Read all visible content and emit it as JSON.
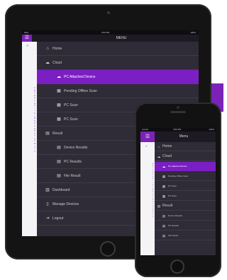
{
  "colors": {
    "accent": "#7b1fc4",
    "drawer_bg": "#2f2b37",
    "text": "#c9c9c9"
  },
  "tablet": {
    "status": {
      "carrier": "iPad",
      "time": "3:53 PM",
      "battery": "100%"
    },
    "title": "MENU",
    "hamburger_icon": "hamburger-icon",
    "alphabet": [
      "A",
      "B",
      "C",
      "D",
      "E",
      "F",
      "G",
      "H",
      "I",
      "J",
      "K",
      "L",
      "M",
      "N",
      "O",
      "P",
      "Q",
      "R",
      "S",
      "T",
      "U",
      "V",
      "W",
      "X",
      "Y",
      "Z"
    ],
    "menu": [
      {
        "label": "Home",
        "icon": "home-icon",
        "glyph": "⌂"
      },
      {
        "label": "Cloud",
        "icon": "cloud-icon",
        "glyph": "☁"
      },
      {
        "label": "PC Attached Device",
        "icon": "cloud-icon",
        "glyph": "☁"
      },
      {
        "label": "Pending Offline Scan",
        "icon": "scan-icon",
        "glyph": "▦"
      },
      {
        "label": "PC Scan",
        "icon": "scan-icon",
        "glyph": "▦"
      },
      {
        "label": "PC Scan",
        "icon": "scan-icon",
        "glyph": "▦"
      },
      {
        "label": "Result",
        "icon": "result-icon",
        "glyph": "▤"
      },
      {
        "label": "Device Results",
        "icon": "result-icon",
        "glyph": "▤"
      },
      {
        "label": "PC Results",
        "icon": "result-icon",
        "glyph": "▤"
      },
      {
        "label": "File Result",
        "icon": "result-icon",
        "glyph": "▤"
      },
      {
        "label": "Dashboard",
        "icon": "dashboard-icon",
        "glyph": "▥"
      },
      {
        "label": "Manage Devices",
        "icon": "devices-icon",
        "glyph": "▯"
      },
      {
        "label": "Logout",
        "icon": "logout-icon",
        "glyph": "⇥"
      }
    ]
  },
  "phone": {
    "status": {
      "carrier": "Carrier",
      "time": "3:56 PM",
      "battery": "100%"
    },
    "title": "Menu",
    "hamburger_icon": "hamburger-icon",
    "alphabet": [
      "A",
      "B",
      "C",
      "D",
      "E",
      "F",
      "G",
      "H",
      "I",
      "J",
      "K",
      "L",
      "M",
      "N",
      "O",
      "P",
      "Q",
      "R",
      "S",
      "T",
      "U",
      "V",
      "W",
      "X",
      "Y",
      "Z"
    ],
    "menu": [
      {
        "label": "Home",
        "icon": "home-icon",
        "glyph": "⌂"
      },
      {
        "label": "Cloud",
        "icon": "cloud-icon",
        "glyph": "☁"
      },
      {
        "label": "PC Attached Device",
        "icon": "cloud-icon",
        "glyph": "☁"
      },
      {
        "label": "Pending Offline Scan",
        "icon": "scan-icon",
        "glyph": "▦"
      },
      {
        "label": "PC Scan",
        "icon": "scan-icon",
        "glyph": "▦"
      },
      {
        "label": "PC Scan",
        "icon": "scan-icon",
        "glyph": "▦"
      },
      {
        "label": "Result",
        "icon": "result-icon",
        "glyph": "▤"
      },
      {
        "label": "Device Results",
        "icon": "result-icon",
        "glyph": "▤"
      },
      {
        "label": "PC Results",
        "icon": "result-icon",
        "glyph": "▤"
      },
      {
        "label": "File Result",
        "icon": "result-icon",
        "glyph": "▤"
      }
    ]
  }
}
